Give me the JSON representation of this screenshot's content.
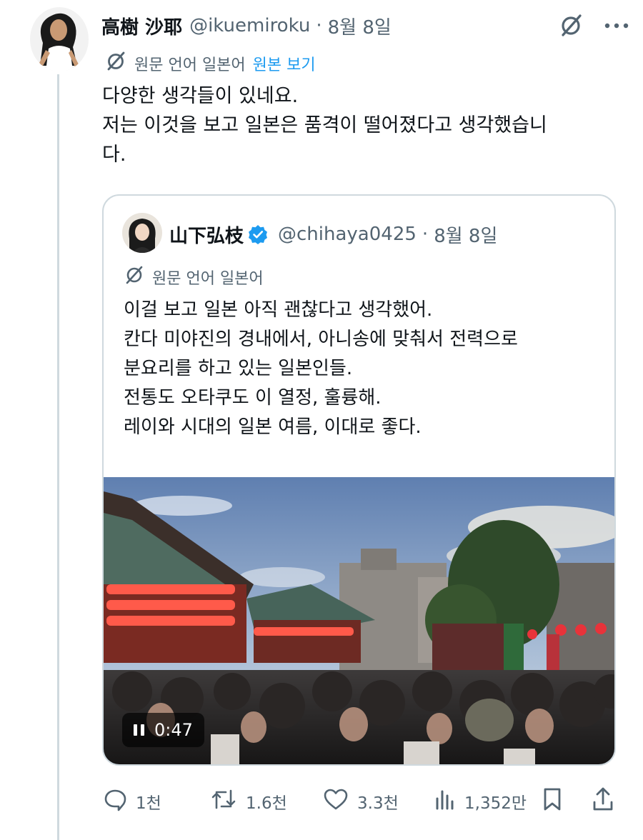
{
  "tweet": {
    "author_name": "高樹 沙耶",
    "handle": "@ikuemiroku",
    "separator": "·",
    "date": "8월 8일",
    "translate_note": "원문 언어 일본어",
    "translate_link": "원본 보기",
    "text_lines": [
      "다양한 생각들이 있네요.",
      "저는 이것을 보고 일본은 품격이 떨어졌다고 생각했습니",
      "다."
    ]
  },
  "quote": {
    "author_name": "山下弘枝",
    "verified": true,
    "handle": "@chihaya0425",
    "separator": "·",
    "date": "8월 8일",
    "translate_note": "원문 언어 일본어",
    "text_lines": [
      "이걸 보고 일본 아직 괜찮다고 생각했어.",
      "칸다 미야진의 경내에서, 아니송에 맞춰서 전력으로",
      "분요리를 하고 있는 일본인들.",
      "전통도 오타쿠도 이 열정, 훌륭해.",
      "레이와 시대의 일본 여름, 이대로 좋다."
    ],
    "video_time": "0:47"
  },
  "actions": {
    "replies": "1천",
    "reposts": "1.6천",
    "likes": "3.3천",
    "views": "1,352만"
  },
  "colors": {
    "text": "#0f1419",
    "muted": "#536471",
    "link": "#1d9bf0",
    "border": "#cfd9de",
    "verified": "#1d9bf0"
  },
  "icons": {
    "header": [
      "grok-slash-icon",
      "more-icon"
    ],
    "actions": [
      "reply-icon",
      "repost-icon",
      "like-icon",
      "views-icon",
      "bookmark-icon",
      "share-icon"
    ]
  }
}
